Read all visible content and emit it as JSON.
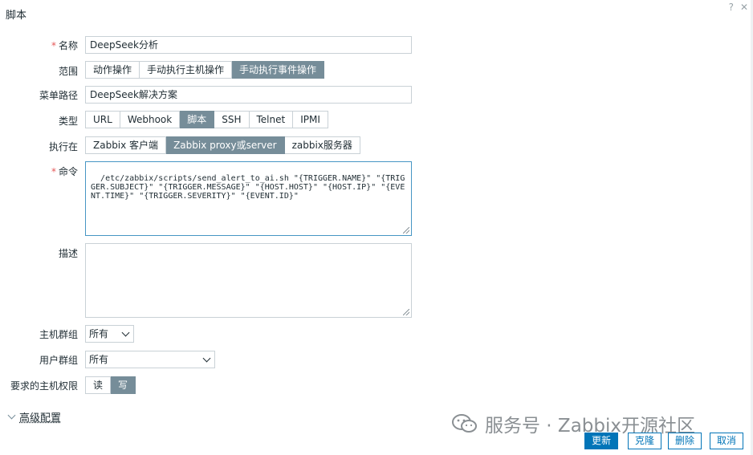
{
  "dialog": {
    "title": "脚本",
    "help_glyph": "?",
    "close_glyph": "✕"
  },
  "form": {
    "name": {
      "label": "名称",
      "required_mark": "*",
      "value": "DeepSeek分析"
    },
    "scope": {
      "label": "范围",
      "options": [
        "动作操作",
        "手动执行主机操作",
        "手动执行事件操作"
      ],
      "selected": 2
    },
    "menu_path": {
      "label": "菜单路径",
      "value": "DeepSeek解决方案"
    },
    "type": {
      "label": "类型",
      "options": [
        "URL",
        "Webhook",
        "脚本",
        "SSH",
        "Telnet",
        "IPMI"
      ],
      "selected": 2
    },
    "execute_on": {
      "label": "执行在",
      "options": [
        "Zabbix 客户端",
        "Zabbix proxy或server",
        "zabbix服务器"
      ],
      "selected": 1
    },
    "command": {
      "label": "命令",
      "required_mark": "*",
      "value": "/etc/zabbix/scripts/send_alert_to_ai.sh \"{TRIGGER.NAME}\" \"{TRIGGER.SUBJECT}\" \"{TRIGGER.MESSAGE}\" \"{HOST.HOST}\" \"{HOST.IP}\" \"{EVENT.TIME}\" \"{TRIGGER.SEVERITY}\" \"{EVENT.ID}\""
    },
    "description": {
      "label": "描述",
      "value": ""
    },
    "host_group": {
      "label": "主机群组",
      "value": "所有"
    },
    "user_group": {
      "label": "用户群组",
      "value": "所有"
    },
    "host_permission": {
      "label": "要求的主机权限",
      "options": [
        "读",
        "写"
      ],
      "selected": 1
    }
  },
  "advanced": {
    "label": "高级配置"
  },
  "watermark": {
    "text": "服务号 · Zabbix开源社区"
  },
  "buttons": {
    "update": "更新",
    "clone": "克隆",
    "delete": "删除",
    "cancel": "取消"
  },
  "colors": {
    "primary": "#0275b8",
    "segment_active": "#768d99",
    "required": "#e45959"
  }
}
